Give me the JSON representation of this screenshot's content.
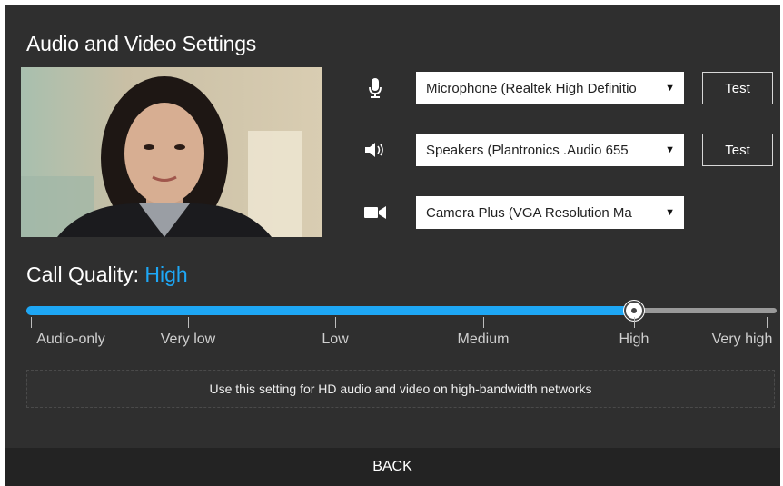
{
  "window": {
    "title": "Audio and Video Settings"
  },
  "devices": {
    "microphone": {
      "icon": "microphone-icon",
      "value": "Microphone (Realtek High Definitio",
      "test_label": "Test"
    },
    "speakers": {
      "icon": "speaker-icon",
      "value": "Speakers (Plantronics .Audio 655",
      "test_label": "Test"
    },
    "camera": {
      "icon": "camera-icon",
      "value": "Camera Plus (VGA Resolution Ma"
    },
    "caret": "▼"
  },
  "quality": {
    "label": "Call Quality:",
    "value": "High",
    "value_color": "#1ea7f5",
    "levels": [
      "Audio-only",
      "Very low",
      "Low",
      "Medium",
      "High",
      "Very high"
    ],
    "selected_index": 4,
    "description": "Use this setting for HD audio and video on high-bandwidth networks"
  },
  "footer": {
    "back_label": "BACK"
  }
}
